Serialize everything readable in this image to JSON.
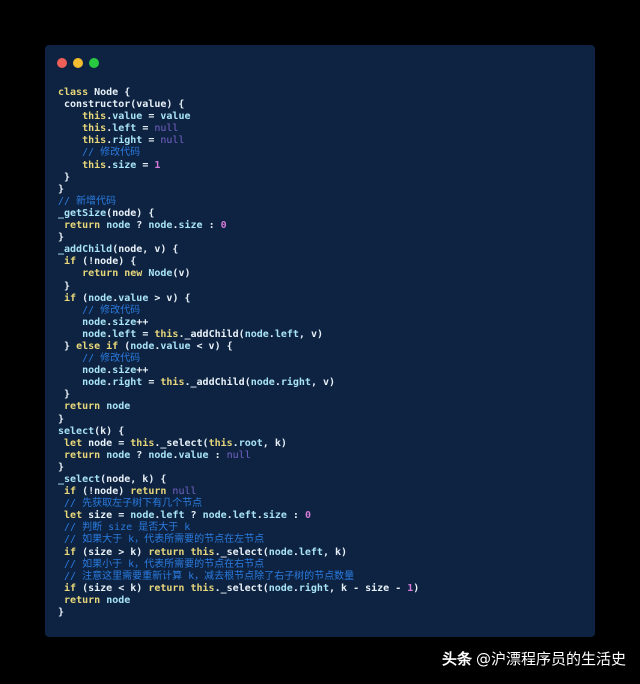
{
  "window": {
    "dots": [
      "#ee5f57",
      "#f5bd30",
      "#28c840"
    ]
  },
  "code_lines": [
    [
      [
        "kw",
        "class "
      ],
      [
        "pl",
        "Node {"
      ]
    ],
    [
      [
        "pl",
        " constructor(value) {"
      ]
    ],
    [
      [
        "pl",
        "    "
      ],
      [
        "kw",
        "this"
      ],
      [
        "pl",
        "."
      ],
      [
        "id",
        "value"
      ],
      [
        "pl",
        " = "
      ],
      [
        "id",
        "value"
      ]
    ],
    [
      [
        "pl",
        "    "
      ],
      [
        "kw",
        "this"
      ],
      [
        "pl",
        "."
      ],
      [
        "id",
        "left"
      ],
      [
        "pl",
        " = "
      ],
      [
        "nu",
        "null"
      ]
    ],
    [
      [
        "pl",
        "    "
      ],
      [
        "kw",
        "this"
      ],
      [
        "pl",
        "."
      ],
      [
        "id",
        "right"
      ],
      [
        "pl",
        " = "
      ],
      [
        "nu",
        "null"
      ]
    ],
    [
      [
        "pl",
        "    "
      ],
      [
        "cm",
        "// 修改代码"
      ]
    ],
    [
      [
        "pl",
        "    "
      ],
      [
        "kw",
        "this"
      ],
      [
        "pl",
        "."
      ],
      [
        "id",
        "size"
      ],
      [
        "pl",
        " = "
      ],
      [
        "num",
        "1"
      ]
    ],
    [
      [
        "pl",
        " }"
      ]
    ],
    [
      [
        "pl",
        "}"
      ]
    ],
    [
      [
        "cm",
        "// 新增代码"
      ]
    ],
    [
      [
        "id",
        "_getSize"
      ],
      [
        "pl",
        "(node) {"
      ]
    ],
    [
      [
        "pl",
        " "
      ],
      [
        "kw",
        "return "
      ],
      [
        "id",
        "node"
      ],
      [
        "pl",
        " ? "
      ],
      [
        "id",
        "node"
      ],
      [
        "pl",
        "."
      ],
      [
        "id",
        "size"
      ],
      [
        "pl",
        " : "
      ],
      [
        "num",
        "0"
      ]
    ],
    [
      [
        "pl",
        "}"
      ]
    ],
    [
      [
        "id",
        "_addChild"
      ],
      [
        "pl",
        "(node, v) {"
      ]
    ],
    [
      [
        "pl",
        " "
      ],
      [
        "kw",
        "if"
      ],
      [
        "pl",
        " (!node) {"
      ]
    ],
    [
      [
        "pl",
        "    "
      ],
      [
        "kw",
        "return new "
      ],
      [
        "id",
        "Node"
      ],
      [
        "pl",
        "(v)"
      ]
    ],
    [
      [
        "pl",
        " }"
      ]
    ],
    [
      [
        "pl",
        " "
      ],
      [
        "kw",
        "if"
      ],
      [
        "pl",
        " ("
      ],
      [
        "id",
        "node"
      ],
      [
        "pl",
        "."
      ],
      [
        "id",
        "value"
      ],
      [
        "pl",
        " > v) {"
      ]
    ],
    [
      [
        "pl",
        "    "
      ],
      [
        "cm",
        "// 修改代码"
      ]
    ],
    [
      [
        "pl",
        "    "
      ],
      [
        "id",
        "node"
      ],
      [
        "pl",
        "."
      ],
      [
        "id",
        "size"
      ],
      [
        "pl",
        "++"
      ]
    ],
    [
      [
        "pl",
        "    "
      ],
      [
        "id",
        "node"
      ],
      [
        "pl",
        "."
      ],
      [
        "id",
        "left"
      ],
      [
        "pl",
        " = "
      ],
      [
        "kw",
        "this"
      ],
      [
        "pl",
        "._addChild("
      ],
      [
        "id",
        "node"
      ],
      [
        "pl",
        "."
      ],
      [
        "id",
        "left"
      ],
      [
        "pl",
        ", v)"
      ]
    ],
    [
      [
        "pl",
        " } "
      ],
      [
        "kw",
        "else if"
      ],
      [
        "pl",
        " ("
      ],
      [
        "id",
        "node"
      ],
      [
        "pl",
        "."
      ],
      [
        "id",
        "value"
      ],
      [
        "pl",
        " < v) {"
      ]
    ],
    [
      [
        "pl",
        "    "
      ],
      [
        "cm",
        "// 修改代码"
      ]
    ],
    [
      [
        "pl",
        "    "
      ],
      [
        "id",
        "node"
      ],
      [
        "pl",
        "."
      ],
      [
        "id",
        "size"
      ],
      [
        "pl",
        "++"
      ]
    ],
    [
      [
        "pl",
        "    "
      ],
      [
        "id",
        "node"
      ],
      [
        "pl",
        "."
      ],
      [
        "id",
        "right"
      ],
      [
        "pl",
        " = "
      ],
      [
        "kw",
        "this"
      ],
      [
        "pl",
        "._addChild("
      ],
      [
        "id",
        "node"
      ],
      [
        "pl",
        "."
      ],
      [
        "id",
        "right"
      ],
      [
        "pl",
        ", v)"
      ]
    ],
    [
      [
        "pl",
        " }"
      ]
    ],
    [
      [
        "pl",
        " "
      ],
      [
        "kw",
        "return "
      ],
      [
        "id",
        "node"
      ]
    ],
    [
      [
        "pl",
        "}"
      ]
    ],
    [
      [
        "id",
        "select"
      ],
      [
        "pl",
        "(k) {"
      ]
    ],
    [
      [
        "pl",
        " "
      ],
      [
        "kw",
        "let "
      ],
      [
        "pl",
        "node = "
      ],
      [
        "kw",
        "this"
      ],
      [
        "pl",
        "._select("
      ],
      [
        "kw",
        "this"
      ],
      [
        "pl",
        "."
      ],
      [
        "id",
        "root"
      ],
      [
        "pl",
        ", k)"
      ]
    ],
    [
      [
        "pl",
        " "
      ],
      [
        "kw",
        "return "
      ],
      [
        "id",
        "node"
      ],
      [
        "pl",
        " ? "
      ],
      [
        "id",
        "node"
      ],
      [
        "pl",
        "."
      ],
      [
        "id",
        "value"
      ],
      [
        "pl",
        " : "
      ],
      [
        "nu",
        "null"
      ]
    ],
    [
      [
        "pl",
        "}"
      ]
    ],
    [
      [
        "id",
        "_select"
      ],
      [
        "pl",
        "(node, k) {"
      ]
    ],
    [
      [
        "pl",
        " "
      ],
      [
        "kw",
        "if"
      ],
      [
        "pl",
        " (!node) "
      ],
      [
        "kw",
        "return "
      ],
      [
        "nu",
        "null"
      ]
    ],
    [
      [
        "pl",
        " "
      ],
      [
        "cm",
        "// 先获取左子树下有几个节点"
      ]
    ],
    [
      [
        "pl",
        " "
      ],
      [
        "kw",
        "let "
      ],
      [
        "pl",
        "size = "
      ],
      [
        "id",
        "node"
      ],
      [
        "pl",
        "."
      ],
      [
        "id",
        "left"
      ],
      [
        "pl",
        " ? "
      ],
      [
        "id",
        "node"
      ],
      [
        "pl",
        "."
      ],
      [
        "id",
        "left"
      ],
      [
        "pl",
        "."
      ],
      [
        "id",
        "size"
      ],
      [
        "pl",
        " : "
      ],
      [
        "num",
        "0"
      ]
    ],
    [
      [
        "pl",
        " "
      ],
      [
        "cm",
        "// 判断 size 是否大于 k"
      ]
    ],
    [
      [
        "pl",
        " "
      ],
      [
        "cm",
        "// 如果大于 k，代表所需要的节点在左节点"
      ]
    ],
    [
      [
        "pl",
        " "
      ],
      [
        "kw",
        "if"
      ],
      [
        "pl",
        " (size > k) "
      ],
      [
        "kw",
        "return this"
      ],
      [
        "pl",
        "._select("
      ],
      [
        "id",
        "node"
      ],
      [
        "pl",
        "."
      ],
      [
        "id",
        "left"
      ],
      [
        "pl",
        ", k)"
      ]
    ],
    [
      [
        "pl",
        " "
      ],
      [
        "cm",
        "// 如果小于 k，代表所需要的节点在右节点"
      ]
    ],
    [
      [
        "pl",
        " "
      ],
      [
        "cm",
        "// 注意这里需要重新计算 k，减去根节点除了右子树的节点数量"
      ]
    ],
    [
      [
        "pl",
        " "
      ],
      [
        "kw",
        "if"
      ],
      [
        "pl",
        " (size < k) "
      ],
      [
        "kw",
        "return this"
      ],
      [
        "pl",
        "._select("
      ],
      [
        "id",
        "node"
      ],
      [
        "pl",
        "."
      ],
      [
        "id",
        "right"
      ],
      [
        "pl",
        ", k - size - "
      ],
      [
        "num",
        "1"
      ],
      [
        "pl",
        ")"
      ]
    ],
    [
      [
        "pl",
        " "
      ],
      [
        "kw",
        "return "
      ],
      [
        "id",
        "node"
      ]
    ],
    [
      [
        "pl",
        "}"
      ]
    ]
  ],
  "watermark": {
    "brand": "头条",
    "handle": "@沪漂程序员的生活史"
  }
}
